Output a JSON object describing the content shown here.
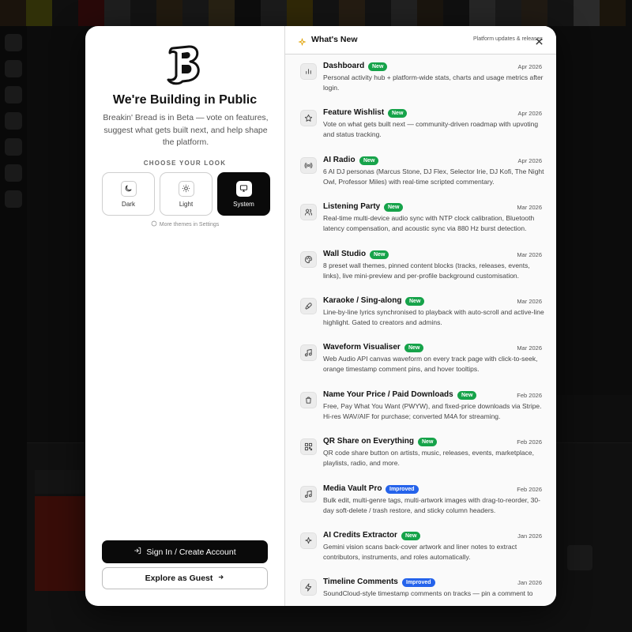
{
  "left": {
    "heading": "We're Building in Public",
    "blurb": "Breakin' Bread is in Beta — vote on features, suggest what gets built next, and help shape the platform.",
    "choose_label": "CHOOSE YOUR LOOK",
    "themes": [
      {
        "label": "Dark",
        "icon": "moon-icon",
        "selected": false
      },
      {
        "label": "Light",
        "icon": "sun-icon",
        "selected": false
      },
      {
        "label": "System",
        "icon": "monitor-icon",
        "selected": true
      }
    ],
    "more_themes": "More themes in Settings",
    "sign_in_label": "Sign In / Create Account",
    "guest_label": "Explore as Guest"
  },
  "right": {
    "title": "What's New",
    "subtitle": "Platform updates & releases",
    "items": [
      {
        "name": "Dashboard",
        "badge": "New",
        "date": "Apr 2026",
        "icon": "bar-chart-icon",
        "desc": "Personal activity hub + platform-wide stats, charts and usage metrics after login."
      },
      {
        "name": "Feature Wishlist",
        "badge": "New",
        "date": "Apr 2026",
        "icon": "star-icon",
        "desc": "Vote on what gets built next — community-driven roadmap with upvoting and status tracking."
      },
      {
        "name": "AI Radio",
        "badge": "New",
        "date": "Apr 2026",
        "icon": "radio-icon",
        "desc": "6 AI DJ personas (Marcus Stone, DJ Flex, Selector Irie, DJ Kofi, The Night Owl, Professor Miles) with real-time scripted commentary."
      },
      {
        "name": "Listening Party",
        "badge": "New",
        "date": "Mar 2026",
        "icon": "users-icon",
        "desc": "Real-time multi-device audio sync with NTP clock calibration, Bluetooth latency compensation, and acoustic sync via 880 Hz burst detection."
      },
      {
        "name": "Wall Studio",
        "badge": "New",
        "date": "Mar 2026",
        "icon": "palette-icon",
        "desc": "8 preset wall themes, pinned content blocks (tracks, releases, events, links), live mini-preview and per-profile background customisation."
      },
      {
        "name": "Karaoke / Sing-along",
        "badge": "New",
        "date": "Mar 2026",
        "icon": "microphone-icon",
        "desc": "Line-by-line lyrics synchronised to playback with auto-scroll and active-line highlight. Gated to creators and admins."
      },
      {
        "name": "Waveform Visualiser",
        "badge": "New",
        "date": "Mar 2026",
        "icon": "music-note-icon",
        "desc": "Web Audio API canvas waveform on every track page with click-to-seek, orange timestamp comment pins, and hover tooltips."
      },
      {
        "name": "Name Your Price / Paid Downloads",
        "badge": "New",
        "date": "Feb 2026",
        "icon": "shopping-bag-icon",
        "desc": "Free, Pay What You Want (PWYW), and fixed-price downloads via Stripe. Hi-res WAV/AIF for purchase; converted M4A for streaming."
      },
      {
        "name": "QR Share on Everything",
        "badge": "New",
        "date": "Feb 2026",
        "icon": "qr-code-icon",
        "desc": "QR code share button on artists, music, releases, events, marketplace, playlists, radio, and more."
      },
      {
        "name": "Media Vault Pro",
        "badge": "Improved",
        "date": "Feb 2026",
        "icon": "music-note-icon",
        "desc": "Bulk edit, multi-genre tags, multi-artwork images with drag-to-reorder, 30-day soft-delete / trash restore, and sticky column headers."
      },
      {
        "name": "AI Credits Extractor",
        "badge": "New",
        "date": "Jan 2026",
        "icon": "sparkles-icon",
        "desc": "Gemini vision scans back-cover artwork and liner notes to extract contributors, instruments, and roles automatically."
      },
      {
        "name": "Timeline Comments",
        "badge": "Improved",
        "date": "Jan 2026",
        "icon": "lightning-icon",
        "desc": "SoundCloud-style timestamp comments on tracks — pin a comment to"
      }
    ]
  },
  "colors": {
    "new_badge": "#16a34a",
    "improved_badge": "#2563eb",
    "primary_button": "#0a0a0a"
  }
}
